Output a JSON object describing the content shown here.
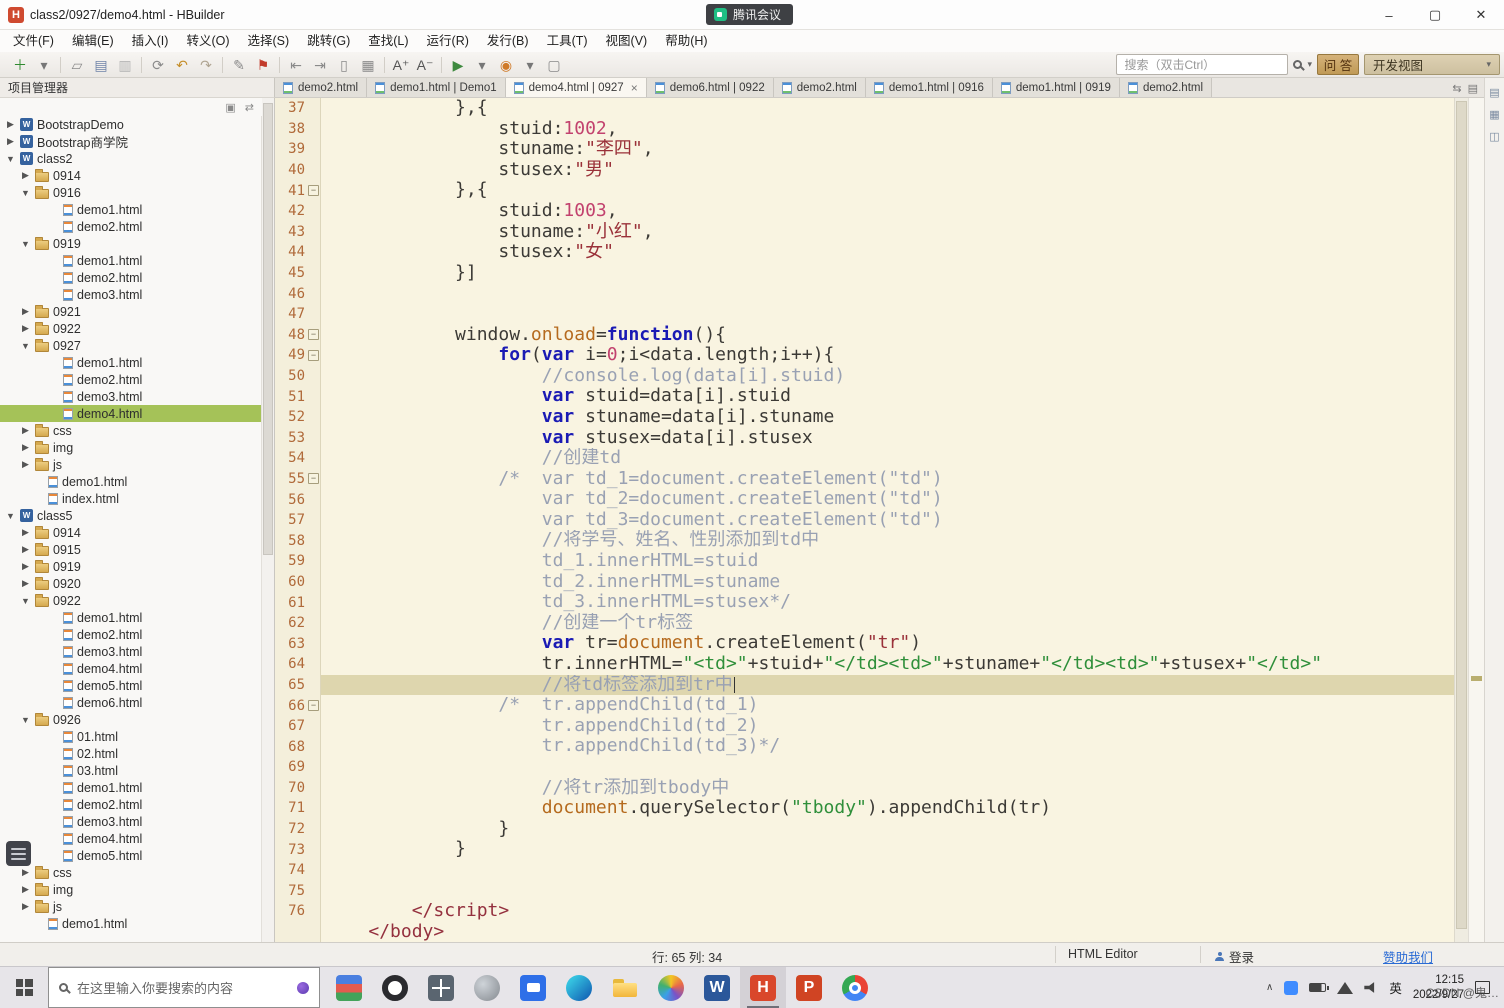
{
  "titlebar": {
    "title": "class2/0927/demo4.html  -  HBuilder",
    "minimize": "–",
    "maximize": "▢",
    "close": "✕"
  },
  "meeting": {
    "label": "腾讯会议"
  },
  "menubar": [
    "文件(F)",
    "编辑(E)",
    "插入(I)",
    "转义(O)",
    "选择(S)",
    "跳转(G)",
    "查找(L)",
    "运行(R)",
    "发行(B)",
    "工具(T)",
    "视图(V)",
    "帮助(H)"
  ],
  "toolbar": {
    "search_placeholder": "搜索（双击Ctrl）",
    "qa_label": "问 答",
    "view_label": "开发视图",
    "icons": [
      {
        "name": "new-file-icon",
        "glyph": "＋",
        "color": "#2f8a2f"
      },
      {
        "name": "new-file-dropdown-icon",
        "glyph": "▾",
        "color": "#777777"
      },
      {
        "sep": true
      },
      {
        "name": "open-project-icon",
        "glyph": "▱",
        "color": "#8a8a8a"
      },
      {
        "name": "save-icon",
        "glyph": "▤",
        "color": "#6f83a8"
      },
      {
        "name": "save-all-icon",
        "glyph": "▥",
        "color": "#b3b3b3"
      },
      {
        "sep": true
      },
      {
        "name": "refresh-icon",
        "glyph": "⟳",
        "color": "#8a8a8a"
      },
      {
        "name": "undo-icon",
        "glyph": "↶",
        "color": "#c58e2a"
      },
      {
        "name": "redo-icon",
        "glyph": "↷",
        "color": "#b0a592"
      },
      {
        "sep": true
      },
      {
        "name": "format-icon",
        "glyph": "✎",
        "color": "#8a8a8a"
      },
      {
        "name": "bookmark-icon",
        "glyph": "⚑",
        "color": "#c23b2a"
      },
      {
        "sep": true
      },
      {
        "name": "nav-back-icon",
        "glyph": "⇤",
        "color": "#8a8a8a"
      },
      {
        "name": "nav-forward-icon",
        "glyph": "⇥",
        "color": "#8a8a8a"
      },
      {
        "name": "edit-column-icon",
        "glyph": "▯",
        "color": "#8a8a8a"
      },
      {
        "name": "grid-view-icon",
        "glyph": "▦",
        "color": "#8a8a8a"
      },
      {
        "sep": true
      },
      {
        "name": "font-increase-icon",
        "glyph": "A⁺",
        "color": "#555555"
      },
      {
        "name": "font-decrease-icon",
        "glyph": "A⁻",
        "color": "#555555"
      },
      {
        "sep": true
      },
      {
        "name": "run-icon",
        "glyph": "▶",
        "color": "#3f8a3f"
      },
      {
        "name": "run-dropdown-icon",
        "glyph": "▾",
        "color": "#777777"
      },
      {
        "name": "browser-run-icon",
        "glyph": "◉",
        "color": "#d07a28"
      },
      {
        "name": "browser-dropdown-icon",
        "glyph": "▾",
        "color": "#777777"
      },
      {
        "name": "preview-icon",
        "glyph": "▢",
        "color": "#8a8a8a"
      }
    ]
  },
  "tabs": [
    {
      "label": "demo2.html"
    },
    {
      "label": "demo1.html | Demo1"
    },
    {
      "label": "demo4.html | 0927",
      "active": true
    },
    {
      "label": "demo6.html | 0922"
    },
    {
      "label": "demo2.html"
    },
    {
      "label": "demo1.html | 0916"
    },
    {
      "label": "demo1.html | 0919"
    },
    {
      "label": "demo2.html"
    }
  ],
  "sidebar": {
    "title": "项目管理器",
    "tree": [
      {
        "l": "BootstrapDemo",
        "ic": "w",
        "lv": 0,
        "ar": ">"
      },
      {
        "l": "Bootstrap商学院",
        "ic": "w",
        "lv": 0,
        "ar": ">"
      },
      {
        "l": "class2",
        "ic": "w",
        "lv": 0,
        "ar": "v"
      },
      {
        "l": "0914",
        "ic": "f",
        "lv": 1,
        "ar": ">"
      },
      {
        "l": "0916",
        "ic": "f",
        "lv": 1,
        "ar": "v"
      },
      {
        "l": "demo1.html",
        "ic": "h",
        "lv": 2
      },
      {
        "l": "demo2.html",
        "ic": "h",
        "lv": 2
      },
      {
        "l": "0919",
        "ic": "f",
        "lv": 1,
        "ar": "v"
      },
      {
        "l": "demo1.html",
        "ic": "h",
        "lv": 2
      },
      {
        "l": "demo2.html",
        "ic": "h",
        "lv": 2
      },
      {
        "l": "demo3.html",
        "ic": "h",
        "lv": 2
      },
      {
        "l": "0921",
        "ic": "f",
        "lv": 1,
        "ar": ">"
      },
      {
        "l": "0922",
        "ic": "f",
        "lv": 1,
        "ar": ">"
      },
      {
        "l": "0927",
        "ic": "f",
        "lv": 1,
        "ar": "v"
      },
      {
        "l": "demo1.html",
        "ic": "h",
        "lv": 2
      },
      {
        "l": "demo2.html",
        "ic": "h",
        "lv": 2
      },
      {
        "l": "demo3.html",
        "ic": "h",
        "lv": 2
      },
      {
        "l": "demo4.html",
        "ic": "h",
        "lv": 2,
        "sel": true
      },
      {
        "l": "css",
        "ic": "f",
        "lv": 1,
        "ar": ">"
      },
      {
        "l": "img",
        "ic": "f",
        "lv": 1,
        "ar": ">"
      },
      {
        "l": "js",
        "ic": "f",
        "lv": 1,
        "ar": ">"
      },
      {
        "l": "demo1.html",
        "ic": "h",
        "lv": 1
      },
      {
        "l": "index.html",
        "ic": "h",
        "lv": 1
      },
      {
        "l": "class5",
        "ic": "w",
        "lv": 0,
        "ar": "v"
      },
      {
        "l": "0914",
        "ic": "f",
        "lv": 1,
        "ar": ">"
      },
      {
        "l": "0915",
        "ic": "f",
        "lv": 1,
        "ar": ">"
      },
      {
        "l": "0919",
        "ic": "f",
        "lv": 1,
        "ar": ">"
      },
      {
        "l": "0920",
        "ic": "f",
        "lv": 1,
        "ar": ">"
      },
      {
        "l": "0922",
        "ic": "f",
        "lv": 1,
        "ar": "v"
      },
      {
        "l": "demo1.html",
        "ic": "h",
        "lv": 2
      },
      {
        "l": "demo2.html",
        "ic": "h",
        "lv": 2
      },
      {
        "l": "demo3.html",
        "ic": "h",
        "lv": 2
      },
      {
        "l": "demo4.html",
        "ic": "h",
        "lv": 2
      },
      {
        "l": "demo5.html",
        "ic": "h",
        "lv": 2
      },
      {
        "l": "demo6.html",
        "ic": "h",
        "lv": 2
      },
      {
        "l": "0926",
        "ic": "f",
        "lv": 1,
        "ar": "v"
      },
      {
        "l": "01.html",
        "ic": "h",
        "lv": 2
      },
      {
        "l": "02.html",
        "ic": "h",
        "lv": 2
      },
      {
        "l": "03.html",
        "ic": "h",
        "lv": 2
      },
      {
        "l": "demo1.html",
        "ic": "h",
        "lv": 2
      },
      {
        "l": "demo2.html",
        "ic": "h",
        "lv": 2
      },
      {
        "l": "demo3.html",
        "ic": "h",
        "lv": 2
      },
      {
        "l": "demo4.html",
        "ic": "h",
        "lv": 2
      },
      {
        "l": "demo5.html",
        "ic": "h",
        "lv": 2
      },
      {
        "l": "css",
        "ic": "f",
        "lv": 1,
        "ar": ">"
      },
      {
        "l": "img",
        "ic": "f",
        "lv": 1,
        "ar": ">"
      },
      {
        "l": "js",
        "ic": "f",
        "lv": 1,
        "ar": ">"
      },
      {
        "l": "demo1.html",
        "ic": "h",
        "lv": 1
      }
    ]
  },
  "editor": {
    "lines": [
      {
        "n": "37",
        "t": [
          [
            "p",
            "            },{"
          ]
        ]
      },
      {
        "n": "38",
        "t": [
          [
            "p",
            "                stuid:"
          ],
          [
            "n",
            "1002"
          ],
          [
            "p",
            ","
          ]
        ]
      },
      {
        "n": "39",
        "t": [
          [
            "p",
            "                stuname:"
          ],
          [
            "s",
            "\"李四\""
          ],
          [
            "p",
            ","
          ]
        ]
      },
      {
        "n": "40",
        "t": [
          [
            "p",
            "                stusex:"
          ],
          [
            "s",
            "\"男\""
          ]
        ]
      },
      {
        "n": "41",
        "fold": true,
        "t": [
          [
            "p",
            "            },{"
          ]
        ]
      },
      {
        "n": "42",
        "t": [
          [
            "p",
            "                stuid:"
          ],
          [
            "n",
            "1003"
          ],
          [
            "p",
            ","
          ]
        ]
      },
      {
        "n": "43",
        "t": [
          [
            "p",
            "                stuname:"
          ],
          [
            "s",
            "\"小红\""
          ],
          [
            "p",
            ","
          ]
        ]
      },
      {
        "n": "44",
        "t": [
          [
            "p",
            "                stusex:"
          ],
          [
            "s",
            "\"女\""
          ]
        ]
      },
      {
        "n": "45",
        "t": [
          [
            "p",
            "            }]"
          ]
        ]
      },
      {
        "n": "46",
        "t": []
      },
      {
        "n": "47",
        "t": []
      },
      {
        "n": "48",
        "fold": true,
        "t": [
          [
            "p",
            "            window."
          ],
          [
            "d",
            "onload"
          ],
          [
            "p",
            "="
          ],
          [
            "k",
            "function"
          ],
          [
            "p",
            "(){"
          ]
        ]
      },
      {
        "n": "49",
        "fold": true,
        "t": [
          [
            "p",
            "                "
          ],
          [
            "k",
            "for"
          ],
          [
            "p",
            "("
          ],
          [
            "k",
            "var"
          ],
          [
            "p",
            " i="
          ],
          [
            "n",
            "0"
          ],
          [
            "p",
            ";i<data.length;i++){"
          ]
        ]
      },
      {
        "n": "50",
        "t": [
          [
            "c",
            "                    //console.log(data[i].stuid)"
          ]
        ]
      },
      {
        "n": "51",
        "t": [
          [
            "p",
            "                    "
          ],
          [
            "k",
            "var"
          ],
          [
            "p",
            " stuid=data[i].stuid"
          ]
        ]
      },
      {
        "n": "52",
        "t": [
          [
            "p",
            "                    "
          ],
          [
            "k",
            "var"
          ],
          [
            "p",
            " stuname=data[i].stuname"
          ]
        ]
      },
      {
        "n": "53",
        "t": [
          [
            "p",
            "                    "
          ],
          [
            "k",
            "var"
          ],
          [
            "p",
            " stusex=data[i].stusex"
          ]
        ]
      },
      {
        "n": "54",
        "t": [
          [
            "c",
            "                    //创建td"
          ]
        ]
      },
      {
        "n": "55",
        "fold": true,
        "t": [
          [
            "c",
            "                /*  var td_1=document.createElement(\"td\")"
          ]
        ]
      },
      {
        "n": "56",
        "t": [
          [
            "c",
            "                    var td_2=document.createElement(\"td\")"
          ]
        ]
      },
      {
        "n": "57",
        "t": [
          [
            "c",
            "                    var td_3=document.createElement(\"td\")"
          ]
        ]
      },
      {
        "n": "58",
        "t": [
          [
            "c",
            "                    //将学号、姓名、性别添加到td中"
          ]
        ]
      },
      {
        "n": "59",
        "t": [
          [
            "c",
            "                    td_1.innerHTML=stuid"
          ]
        ]
      },
      {
        "n": "60",
        "t": [
          [
            "c",
            "                    td_2.innerHTML=stuname"
          ]
        ]
      },
      {
        "n": "61",
        "t": [
          [
            "c",
            "                    td_3.innerHTML=stusex*/"
          ]
        ]
      },
      {
        "n": "62",
        "t": [
          [
            "c",
            "                    //创建一个tr标签"
          ]
        ]
      },
      {
        "n": "63",
        "t": [
          [
            "p",
            "                    "
          ],
          [
            "k",
            "var"
          ],
          [
            "p",
            " tr="
          ],
          [
            "d",
            "document"
          ],
          [
            "p",
            ".createElement("
          ],
          [
            "s",
            "\"tr\""
          ],
          [
            "p",
            ")"
          ]
        ]
      },
      {
        "n": "64",
        "t": [
          [
            "p",
            "                    tr.innerHTML="
          ],
          [
            "g",
            "\"<td>\""
          ],
          [
            "p",
            "+stuid+"
          ],
          [
            "g",
            "\"</td><td>\""
          ],
          [
            "p",
            "+stuname+"
          ],
          [
            "g",
            "\"</td><td>\""
          ],
          [
            "p",
            "+stusex+"
          ],
          [
            "g",
            "\"</td>\""
          ]
        ]
      },
      {
        "n": "65",
        "hl": true,
        "caret": true,
        "t": [
          [
            "c",
            "                    //将td标签添加到tr中"
          ]
        ]
      },
      {
        "n": "66",
        "fold": true,
        "t": [
          [
            "c",
            "                /*  tr.appendChild(td_1)"
          ]
        ]
      },
      {
        "n": "67",
        "t": [
          [
            "c",
            "                    tr.appendChild(td_2)"
          ]
        ]
      },
      {
        "n": "68",
        "t": [
          [
            "c",
            "                    tr.appendChild(td_3)*/"
          ]
        ]
      },
      {
        "n": "69",
        "t": []
      },
      {
        "n": "70",
        "t": [
          [
            "c",
            "                    //将tr添加到tbody中"
          ]
        ]
      },
      {
        "n": "71",
        "t": [
          [
            "p",
            "                    "
          ],
          [
            "d",
            "document"
          ],
          [
            "p",
            ".querySelector("
          ],
          [
            "g",
            "\"tbody\""
          ],
          [
            "p",
            ").appendChild(tr)"
          ]
        ]
      },
      {
        "n": "72",
        "t": [
          [
            "p",
            "                }"
          ]
        ]
      },
      {
        "n": "73",
        "t": [
          [
            "p",
            "            }"
          ]
        ]
      },
      {
        "n": "74",
        "t": []
      },
      {
        "n": "75",
        "t": []
      },
      {
        "n": "76",
        "t": [
          [
            "p",
            "        "
          ],
          [
            "t",
            "</script>"
          ]
        ]
      },
      {
        "n": "",
        "t": [
          [
            "p",
            "    "
          ],
          [
            "t",
            "</body>"
          ]
        ]
      }
    ]
  },
  "statusbar": {
    "cursor": "行: 65  列: 34",
    "mode": "HTML Editor",
    "login": "登录",
    "sponsor": "赞助我们"
  },
  "taskbar": {
    "search_placeholder": "在这里输入你要搜索的内容",
    "lang": "英",
    "time": "12:15",
    "date": "2022/9/27",
    "apps": [
      {
        "name": "library-app-icon",
        "style": "books"
      },
      {
        "name": "ring-app-icon",
        "style": "ring"
      },
      {
        "name": "panes-app-icon",
        "style": "panes"
      },
      {
        "name": "gray-app-icon",
        "style": "grayc"
      },
      {
        "name": "tencent-meeting-icon",
        "style": "bluesq"
      },
      {
        "name": "edge-icon",
        "style": "edge"
      },
      {
        "name": "file-explorer-icon",
        "style": "folder"
      },
      {
        "name": "color-app-icon",
        "style": "colorc"
      },
      {
        "name": "word-icon",
        "style": "word",
        "letter": "W"
      },
      {
        "name": "hbuilder-icon",
        "style": "hb",
        "letter": "H",
        "active": true
      },
      {
        "name": "powerpoint-icon",
        "style": "ppt",
        "letter": "P"
      },
      {
        "name": "chrome-icon",
        "style": "chrome"
      }
    ]
  },
  "watermark": "CSDN @鬼…"
}
